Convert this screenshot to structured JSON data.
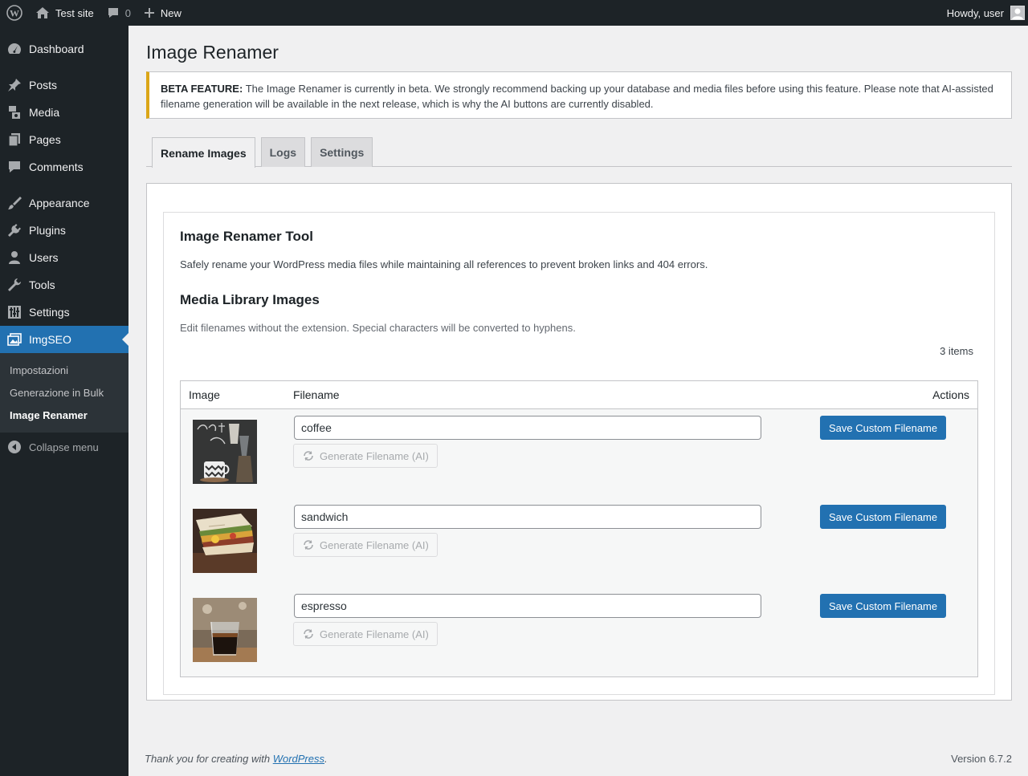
{
  "adminbar": {
    "site_name": "Test site",
    "comments_count": "0",
    "new_label": "New",
    "howdy": "Howdy, user"
  },
  "sidebar": {
    "items": [
      {
        "label": "Dashboard",
        "icon": "dashboard-icon"
      },
      {
        "label": "Posts",
        "icon": "pin-icon"
      },
      {
        "label": "Media",
        "icon": "media-icon"
      },
      {
        "label": "Pages",
        "icon": "pages-icon"
      },
      {
        "label": "Comments",
        "icon": "comment-icon"
      },
      {
        "label": "Appearance",
        "icon": "brush-icon"
      },
      {
        "label": "Plugins",
        "icon": "plug-icon"
      },
      {
        "label": "Users",
        "icon": "user-icon"
      },
      {
        "label": "Tools",
        "icon": "wrench-icon"
      },
      {
        "label": "Settings",
        "icon": "sliders-icon"
      },
      {
        "label": "ImgSEO",
        "icon": "images-icon"
      }
    ],
    "submenu": [
      "Impostazioni",
      "Generazione in Bulk",
      "Image Renamer"
    ],
    "collapse_label": "Collapse menu"
  },
  "page": {
    "title": "Image Renamer",
    "notice_strong": "BETA FEATURE:",
    "notice_text": " The Image Renamer is currently in beta. We strongly recommend backing up your database and media files before using this feature. Please note that AI-assisted filename generation will be available in the next release, which is why the AI buttons are currently disabled."
  },
  "tabs": [
    "Rename Images",
    "Logs",
    "Settings"
  ],
  "tool": {
    "title": "Image Renamer Tool",
    "description": "Safely rename your WordPress media files while maintaining all references to prevent broken links and 404 errors.",
    "library_title": "Media Library Images",
    "library_description": "Edit filenames without the extension. Special characters will be converted to hyphens.",
    "items_count": "3 items"
  },
  "table": {
    "headers": {
      "image": "Image",
      "filename": "Filename",
      "actions": "Actions"
    },
    "rows": [
      {
        "filename": "coffee",
        "ai_label": "Generate Filename (AI)",
        "save_label": "Save Custom Filename"
      },
      {
        "filename": "sandwich",
        "ai_label": "Generate Filename (AI)",
        "save_label": "Save Custom Filename"
      },
      {
        "filename": "espresso",
        "ai_label": "Generate Filename (AI)",
        "save_label": "Save Custom Filename"
      }
    ]
  },
  "footer": {
    "thanks_prefix": "Thank you for creating with ",
    "thanks_link": "WordPress",
    "thanks_suffix": ".",
    "version": "Version 6.7.2"
  },
  "colors": {
    "accent": "#2271b1",
    "adminbar": "#1d2327",
    "notice_warning": "#dba617"
  }
}
